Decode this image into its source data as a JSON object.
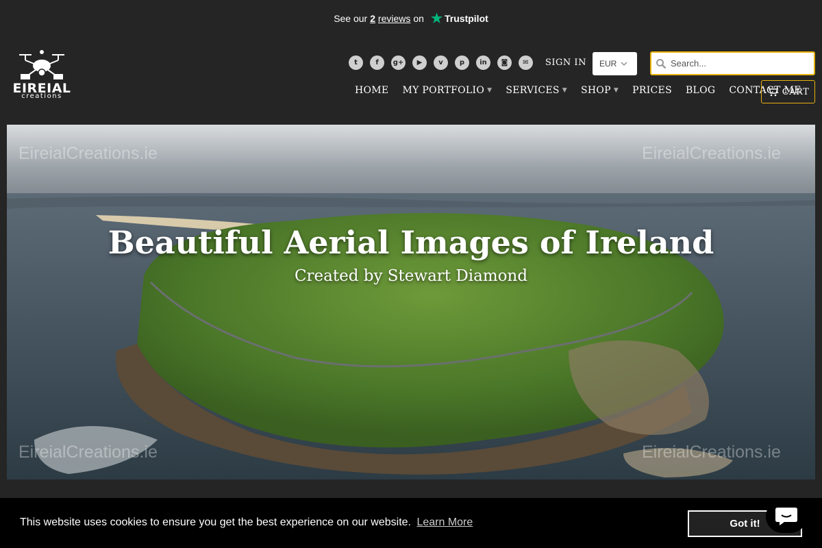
{
  "trustpilot": {
    "prefix": "See our",
    "count": "2",
    "reviews_label": "reviews",
    "suffix": "on",
    "brand": "Trustpilot",
    "star_color": "#00b67a"
  },
  "logo": {
    "name": "EIREIAL",
    "sub": "creations",
    "icon": "drone-icon"
  },
  "socials": [
    {
      "icon": "twitter-icon",
      "glyph": "t"
    },
    {
      "icon": "facebook-icon",
      "glyph": "f"
    },
    {
      "icon": "google-plus-icon",
      "glyph": "g+"
    },
    {
      "icon": "youtube-icon",
      "glyph": "▶"
    },
    {
      "icon": "vimeo-icon",
      "glyph": "v"
    },
    {
      "icon": "pinterest-icon",
      "glyph": "p"
    },
    {
      "icon": "linkedin-icon",
      "glyph": "in"
    },
    {
      "icon": "instagram-icon",
      "glyph": "◙"
    },
    {
      "icon": "email-icon",
      "glyph": "✉"
    }
  ],
  "header": {
    "signin": "SIGN IN",
    "currency": "EUR",
    "search_placeholder": "Search...",
    "cart": "CART",
    "accent": "#e8b20e"
  },
  "nav": {
    "home": "HOME",
    "portfolio": "MY PORTFOLIO",
    "services": "SERVICES",
    "shop": "SHOP",
    "prices": "PRICES",
    "blog": "BLOG",
    "contact": "CONTACT ME"
  },
  "hero": {
    "title": "Beautiful Aerial Images of Ireland",
    "subtitle": "Created by Stewart Diamond",
    "watermark": "EireialCreations.ie"
  },
  "cookie": {
    "message": "This website uses cookies to ensure you get the best experience on our website.",
    "learn_more": "Learn More",
    "button": "Got it!"
  }
}
